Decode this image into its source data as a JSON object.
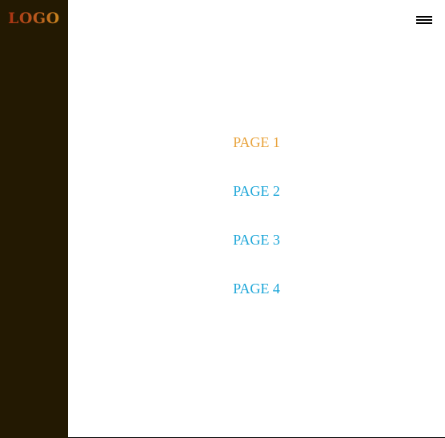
{
  "sidebar": {
    "logo": "LOGO",
    "background": "#231902"
  },
  "header": {
    "menu_icon": "hamburger-menu-icon"
  },
  "nav": {
    "items": [
      {
        "label": "PAGE 1",
        "active": true
      },
      {
        "label": "PAGE 2",
        "active": false
      },
      {
        "label": "PAGE 3",
        "active": false
      },
      {
        "label": "PAGE 4",
        "active": false
      }
    ],
    "link_color": "#1aa5d8",
    "active_color": "#e8a23a"
  }
}
